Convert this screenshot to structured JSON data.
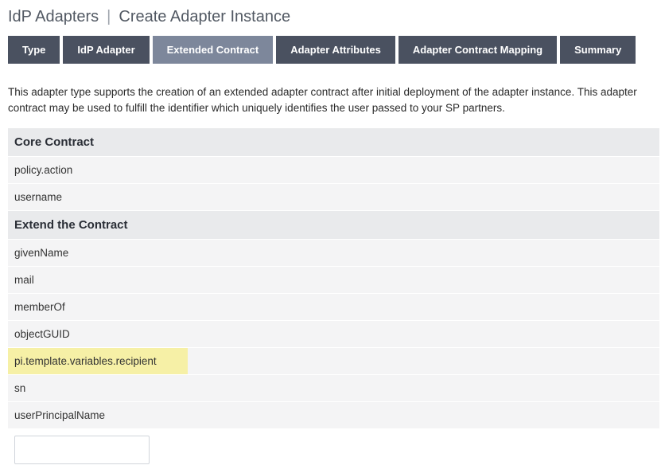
{
  "header": {
    "main": "IdP Adapters",
    "sub": "Create Adapter Instance"
  },
  "tabs": [
    {
      "label": "Type",
      "active": false
    },
    {
      "label": "IdP Adapter",
      "active": false
    },
    {
      "label": "Extended Contract",
      "active": true
    },
    {
      "label": "Adapter Attributes",
      "active": false
    },
    {
      "label": "Adapter Contract Mapping",
      "active": false
    },
    {
      "label": "Summary",
      "active": false
    }
  ],
  "description": "This adapter type supports the creation of an extended adapter contract after initial deployment of the adapter instance. This adapter contract may be used to fulfill the identifier which uniquely identifies the user passed to your SP partners.",
  "sections": {
    "core_header": "Core Contract",
    "core_items": [
      "policy.action",
      "username"
    ],
    "extend_header": "Extend the Contract",
    "extend_items": [
      {
        "value": "givenName",
        "highlighted": false
      },
      {
        "value": "mail",
        "highlighted": false
      },
      {
        "value": "memberOf",
        "highlighted": false
      },
      {
        "value": "objectGUID",
        "highlighted": false
      },
      {
        "value": "pi.template.variables.recipient",
        "highlighted": true
      },
      {
        "value": "sn",
        "highlighted": false
      },
      {
        "value": "userPrincipalName",
        "highlighted": false
      }
    ]
  },
  "input": {
    "value": ""
  }
}
